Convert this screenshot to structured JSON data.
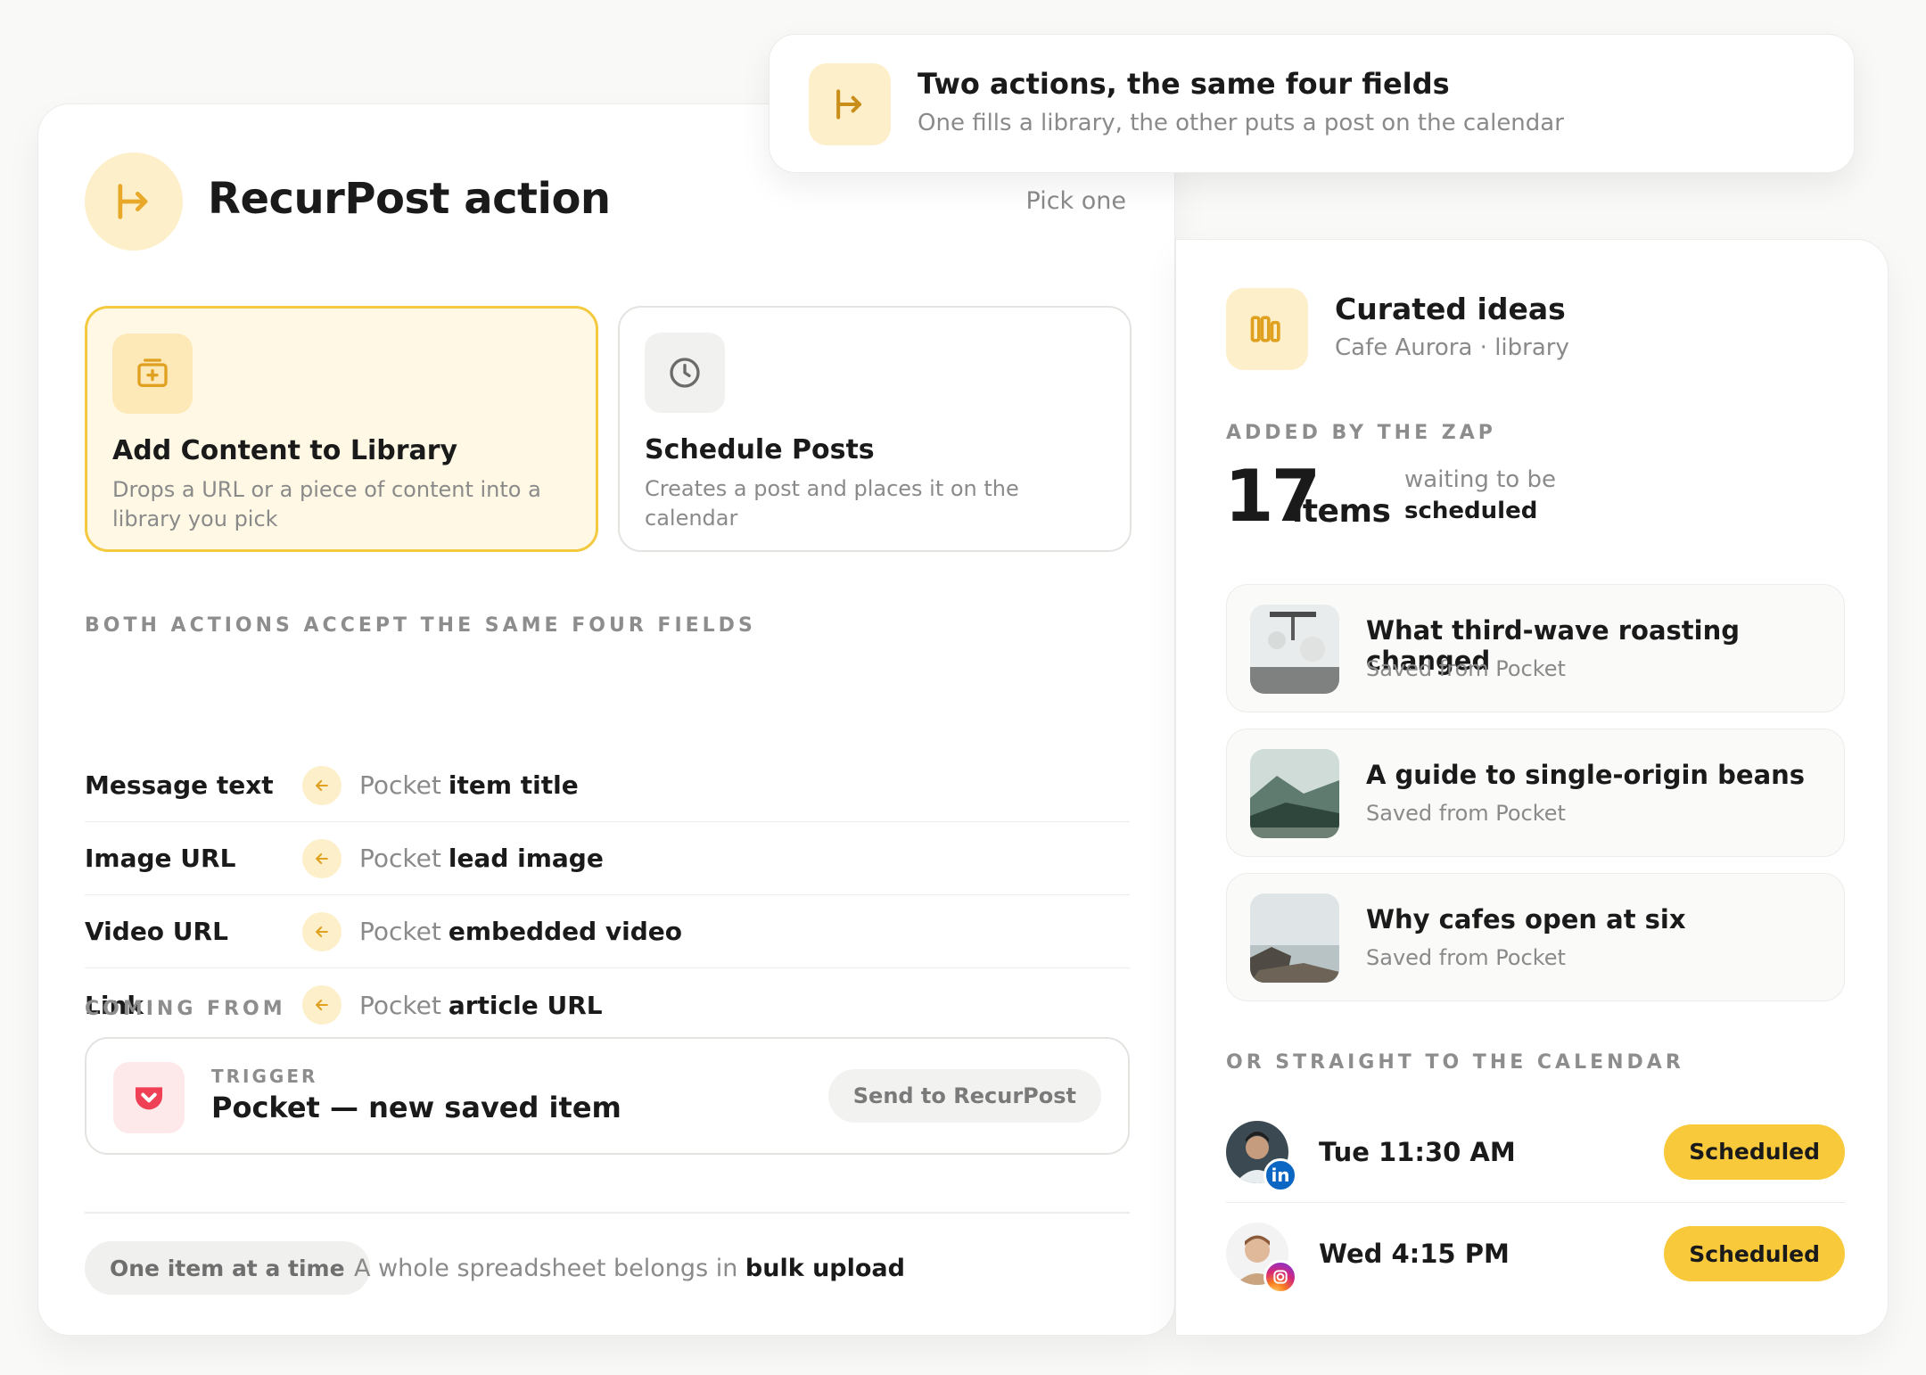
{
  "banner": {
    "title": "Two actions, the same four fields",
    "subtitle": "One fills a library, the other puts a post on the calendar",
    "icon": "split-arrow-icon"
  },
  "main": {
    "title": "RecurPost action",
    "hint": "Pick one",
    "icon": "split-arrow-icon",
    "options": [
      {
        "title": "Add Content to Library",
        "description": "Drops a URL or a piece of content into a library you pick",
        "selected": true,
        "icon": "library-add-icon"
      },
      {
        "title": "Schedule Posts",
        "description": "Creates a post and places it on the calendar",
        "selected": false,
        "icon": "clock-icon"
      }
    ],
    "fields_label": "Both actions accept the same four fields",
    "fields": [
      {
        "name": "Message text",
        "source_app": "Pocket",
        "source_field": "item title"
      },
      {
        "name": "Image URL",
        "source_app": "Pocket",
        "source_field": "lead image"
      },
      {
        "name": "Video URL",
        "source_app": "Pocket",
        "source_field": "embedded video"
      },
      {
        "name": "Link",
        "source_app": "Pocket",
        "source_field": "article URL"
      }
    ],
    "coming_from_label": "Coming from",
    "trigger": {
      "label": "TRIGGER",
      "title": "Pocket — new saved item",
      "button": "Send to RecurPost",
      "icon": "pocket-icon"
    },
    "footer": {
      "chip": "One item at a time",
      "note_prefix": "A whole spreadsheet belongs in",
      "note_link": "bulk upload"
    }
  },
  "side": {
    "title": "Curated ideas",
    "subtitle": "Cafe Aurora · library",
    "icon": "library-icon",
    "added_label": "ADDED BY THE ZAP",
    "count": "17",
    "count_unit": "items",
    "count_note_1": "waiting to be",
    "count_note_2": "scheduled",
    "items": [
      {
        "title": "What third-wave roasting changed",
        "subtitle": "Saved from Pocket"
      },
      {
        "title": "A guide to single-origin beans",
        "subtitle": "Saved from Pocket"
      },
      {
        "title": "Why cafes open at six",
        "subtitle": "Saved from Pocket"
      }
    ],
    "calendar_label": "OR STRAIGHT TO THE CALENDAR",
    "calendar": [
      {
        "time": "Tue 11:30 AM",
        "status": "Scheduled",
        "network": "linkedin-icon",
        "badge_text": "in",
        "badge_color": "#0a66c2"
      },
      {
        "time": "Wed 4:15 PM",
        "status": "Scheduled",
        "network": "instagram-icon",
        "badge_color": "#d62976"
      }
    ]
  },
  "colors": {
    "accent": "#f8c93a",
    "accent_soft": "#fdefc9",
    "selected_border": "#f3c93f",
    "muted_text": "#8a8a8a"
  }
}
